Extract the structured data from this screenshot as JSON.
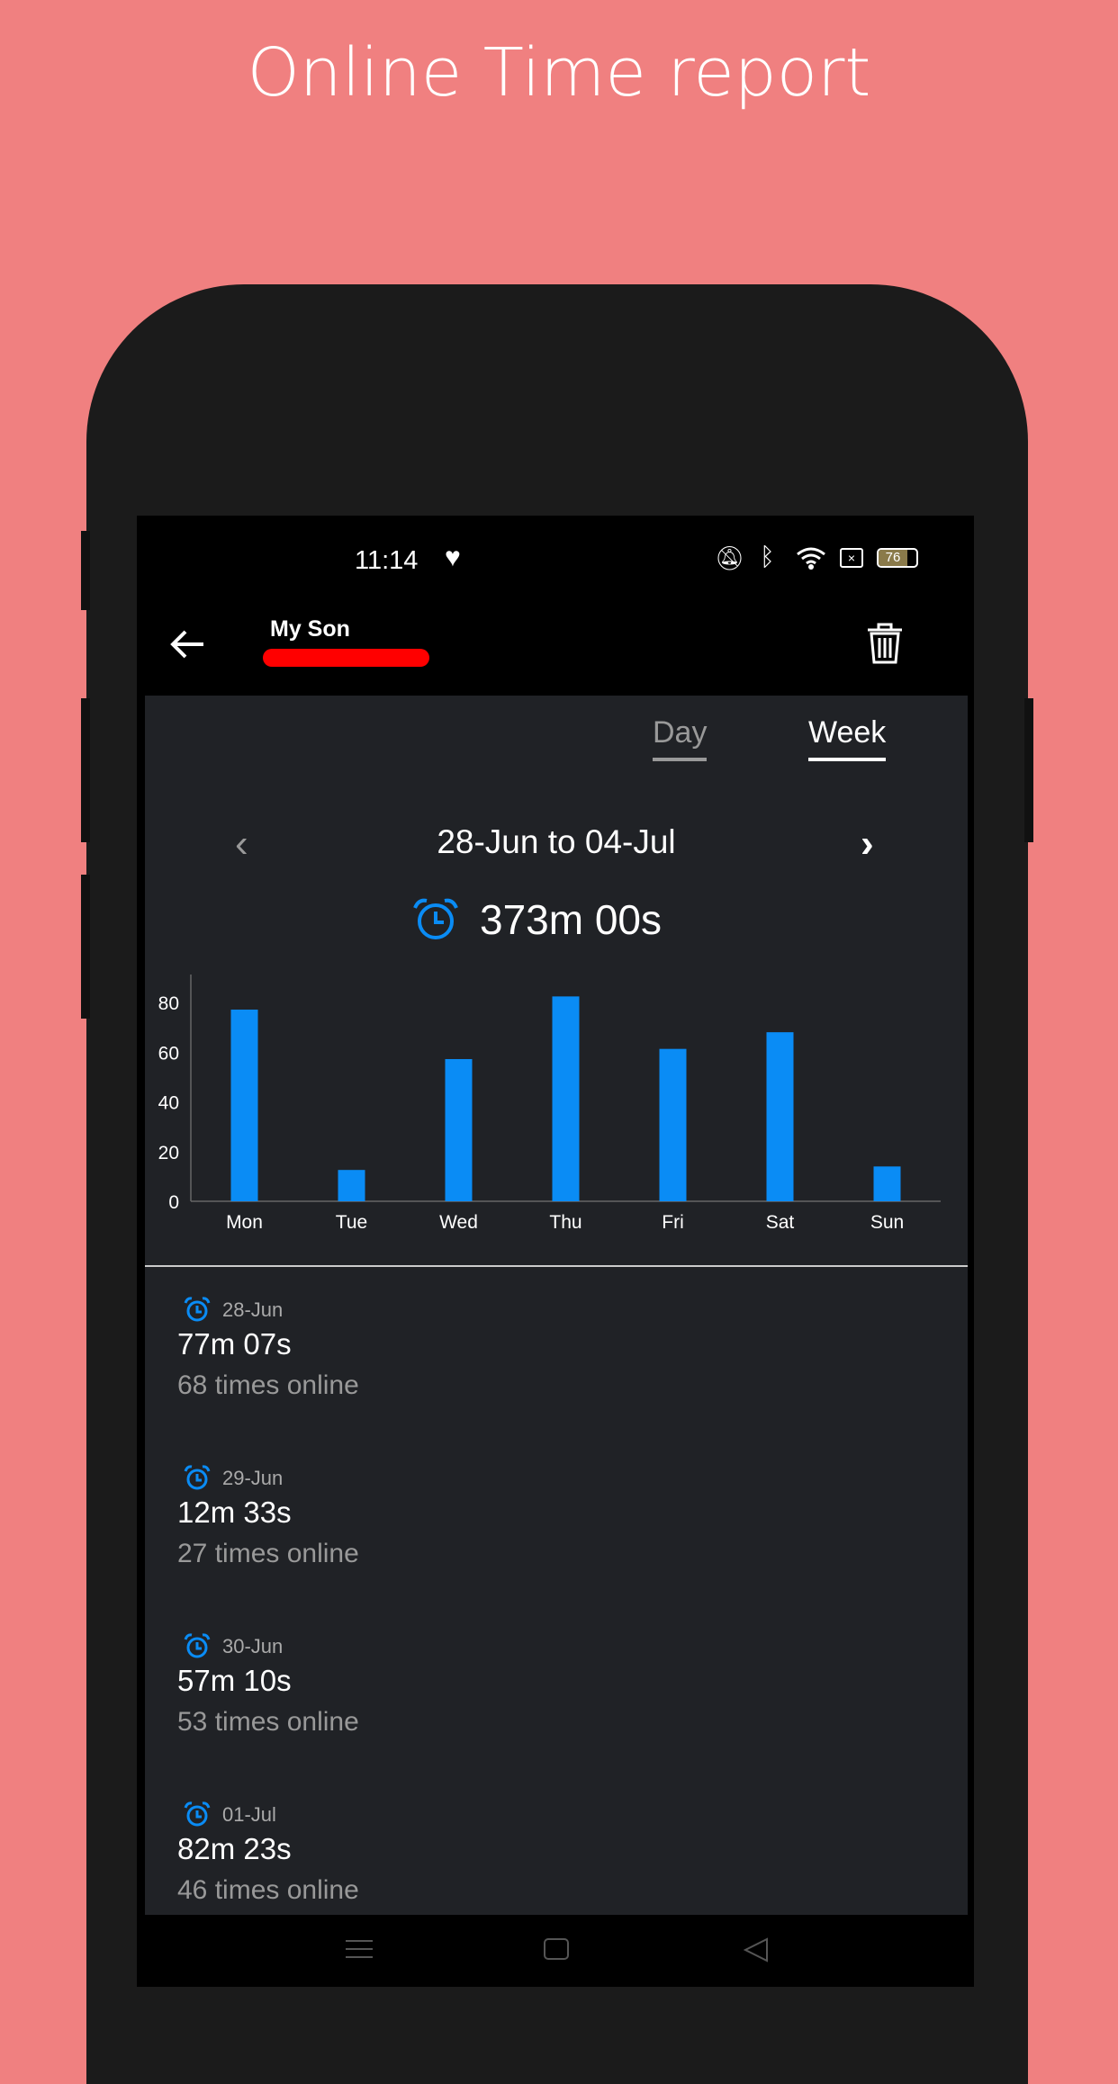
{
  "promo_title": "Online Time report",
  "status": {
    "time": "11:14",
    "battery": "76"
  },
  "header": {
    "name": "My Son"
  },
  "tabs": [
    {
      "label": "Day",
      "active": false
    },
    {
      "label": "Week",
      "active": true
    }
  ],
  "range": "28-Jun to 04-Jul",
  "total": "373m 00s",
  "colors": {
    "accent": "#0a8cf5",
    "bg": "#202226",
    "promo": "#f08080"
  },
  "chart_data": {
    "type": "bar",
    "categories": [
      "Mon",
      "Tue",
      "Wed",
      "Thu",
      "Fri",
      "Sat",
      "Sun"
    ],
    "values": [
      77.1,
      12.6,
      57.2,
      82.4,
      61.3,
      68,
      14
    ],
    "yticks": [
      "0",
      "20",
      "40",
      "60",
      "80"
    ],
    "ylim": [
      0,
      90
    ],
    "grid": false
  },
  "entries": [
    {
      "date": "28-Jun",
      "time": "77m 07s",
      "count": "68 times online"
    },
    {
      "date": "29-Jun",
      "time": "12m 33s",
      "count": "27 times online"
    },
    {
      "date": "30-Jun",
      "time": "57m 10s",
      "count": "53 times online"
    },
    {
      "date": "01-Jul",
      "time": "82m 23s",
      "count": "46 times online"
    }
  ]
}
